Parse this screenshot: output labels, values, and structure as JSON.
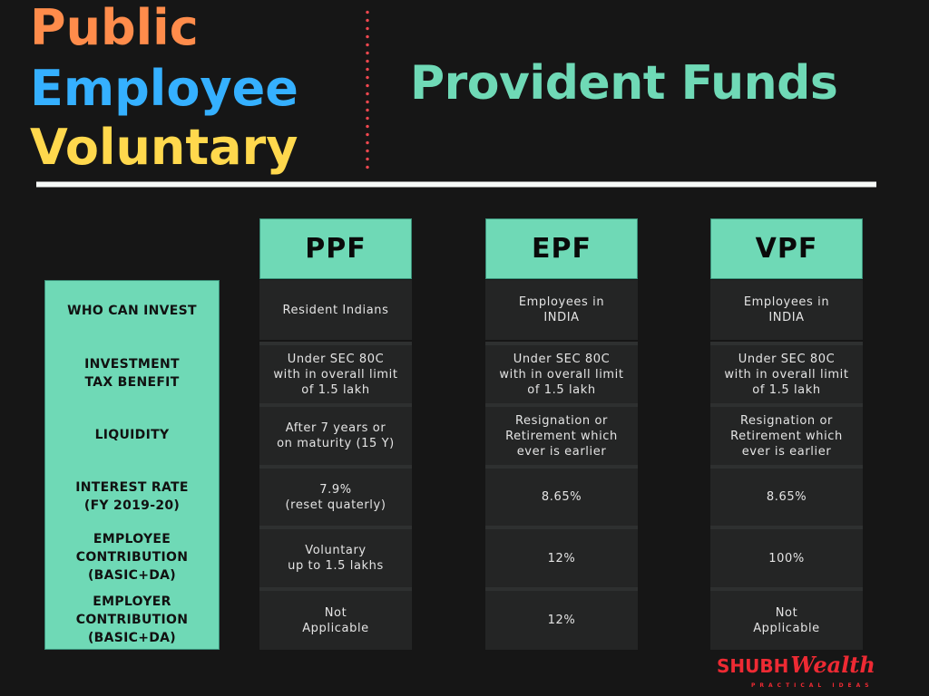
{
  "title": {
    "words": [
      {
        "text": "Public",
        "color": "#ff8c4b"
      },
      {
        "text": "Employee",
        "color": "#35b0ff"
      },
      {
        "text": "Voluntary",
        "color": "#ffd84d"
      }
    ],
    "main": "Provident Funds",
    "main_color": "#6fd9b6",
    "divider_color": "#f0474f"
  },
  "table": {
    "accent_color": "#6fd9b6",
    "row_labels": [
      "WHO CAN INVEST",
      "INVESTMENT\nTAX BENEFIT",
      "LIQUIDITY",
      "INTEREST RATE\n(FY 2019-20)",
      "EMPLOYEE\nCONTRIBUTION\n(BASIC+DA)",
      "EMPLOYER\nCONTRIBUTION\n(BASIC+DA)"
    ],
    "columns": [
      {
        "header": "PPF",
        "cells": [
          "Resident Indians",
          "Under SEC 80C\nwith in overall limit\nof 1.5 lakh",
          "After 7 years or\non maturity (15 Y)",
          "7.9%\n(reset quaterly)",
          "Voluntary\nup to 1.5 lakhs",
          "Not\nApplicable"
        ]
      },
      {
        "header": "EPF",
        "cells": [
          "Employees in\nINDIA",
          "Under SEC 80C\nwith in overall limit\nof 1.5 lakh",
          "Resignation or\nRetirement which\never is earlier",
          "8.65%",
          "12%",
          "12%"
        ]
      },
      {
        "header": "VPF",
        "cells": [
          "Employees in\nINDIA",
          "Under SEC 80C\nwith in overall limit\nof 1.5 lakh",
          "Resignation or\nRetirement which\never is earlier",
          "8.65%",
          "100%",
          "Not\nApplicable"
        ]
      }
    ]
  },
  "logo": {
    "part1": "SHUBH",
    "part2": "Wealth",
    "tagline": "PRACTICAL IDEAS",
    "color": "#ee2a33"
  }
}
